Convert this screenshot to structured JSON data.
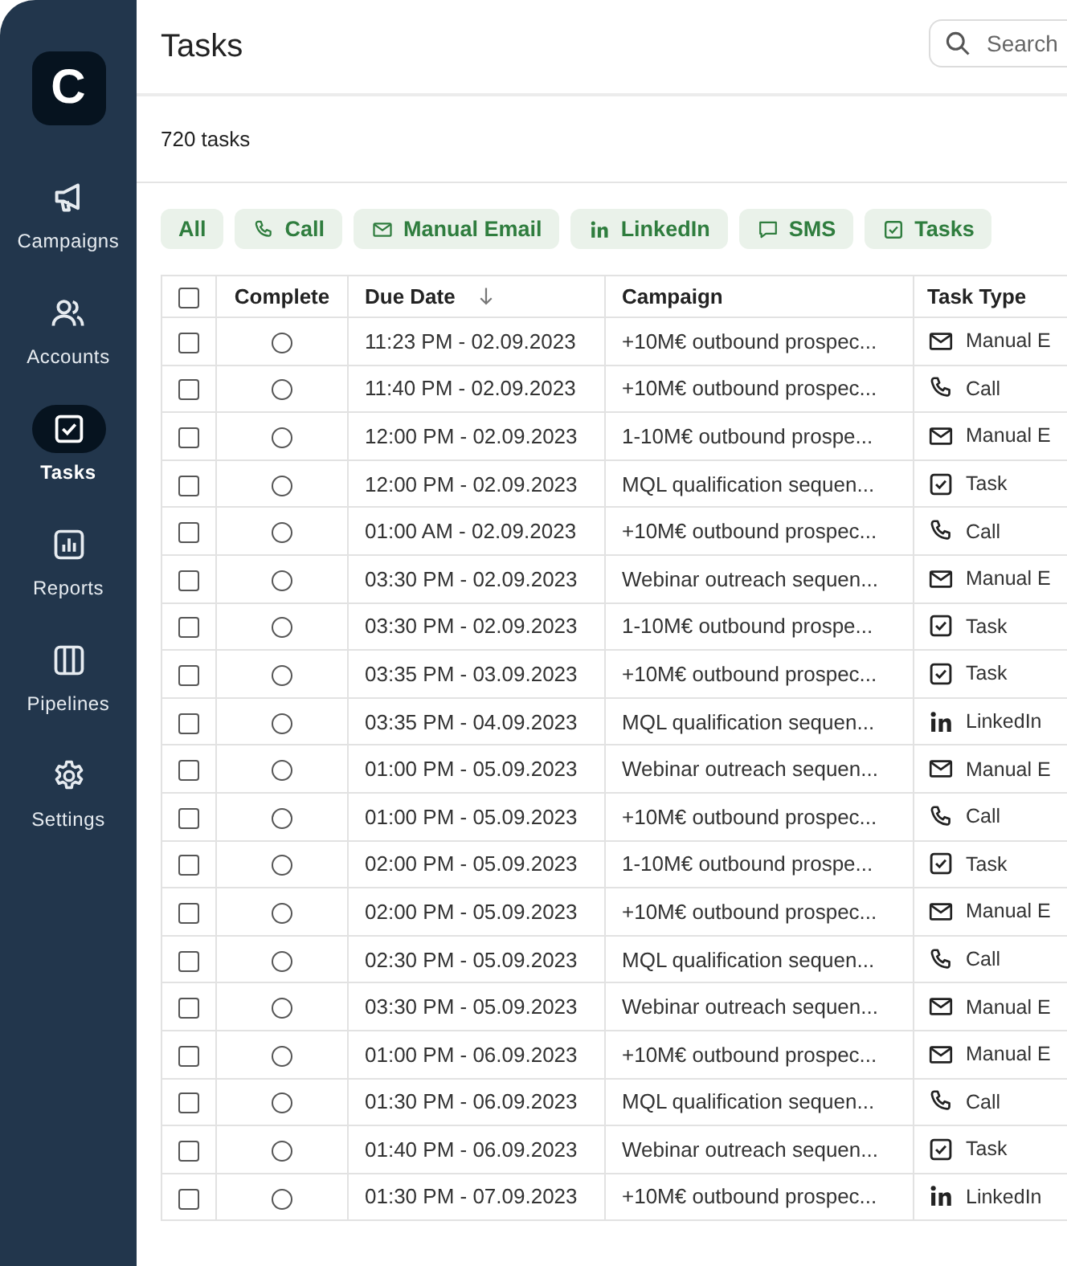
{
  "sidebar": {
    "logo": "C",
    "items": [
      {
        "label": "Campaigns",
        "selected": false
      },
      {
        "label": "Accounts",
        "selected": false
      },
      {
        "label": "Tasks",
        "selected": true
      },
      {
        "label": "Reports",
        "selected": false
      },
      {
        "label": "Pipelines",
        "selected": false
      },
      {
        "label": "Settings",
        "selected": false
      }
    ]
  },
  "header": {
    "title": "Tasks",
    "search": {
      "placeholder": "Search"
    }
  },
  "count": "720 tasks",
  "filters": [
    {
      "label": "All",
      "kind": "all"
    },
    {
      "label": "Call",
      "kind": "call"
    },
    {
      "label": "Manual Email",
      "kind": "email"
    },
    {
      "label": "LinkedIn",
      "kind": "linkedin"
    },
    {
      "label": "SMS",
      "kind": "sms"
    },
    {
      "label": "Tasks",
      "kind": "task"
    }
  ],
  "table": {
    "columns": [
      "Complete",
      "Due Date",
      "Campaign",
      "Task Type"
    ],
    "all_checked": false,
    "rows": [
      {
        "checked": false,
        "complete": false,
        "due": "11:23 PM - 02.09.2023",
        "campaign": "+10M€ outbound prospec...",
        "type": "Manual E",
        "kind": "email"
      },
      {
        "checked": false,
        "complete": false,
        "due": "11:40 PM - 02.09.2023",
        "campaign": "+10M€ outbound prospec...",
        "type": "Call",
        "kind": "call"
      },
      {
        "checked": false,
        "complete": false,
        "due": "12:00 PM - 02.09.2023",
        "campaign": "1-10M€ outbound prospe...",
        "type": "Manual E",
        "kind": "email"
      },
      {
        "checked": false,
        "complete": false,
        "due": "12:00 PM - 02.09.2023",
        "campaign": "MQL qualification sequen...",
        "type": "Task",
        "kind": "task"
      },
      {
        "checked": false,
        "complete": false,
        "due": "01:00 AM - 02.09.2023",
        "campaign": "+10M€ outbound prospec...",
        "type": "Call",
        "kind": "call"
      },
      {
        "checked": false,
        "complete": false,
        "due": "03:30 PM - 02.09.2023",
        "campaign": "Webinar outreach sequen...",
        "type": "Manual E",
        "kind": "email"
      },
      {
        "checked": false,
        "complete": false,
        "due": "03:30 PM - 02.09.2023",
        "campaign": "1-10M€ outbound prospe...",
        "type": "Task",
        "kind": "task"
      },
      {
        "checked": false,
        "complete": false,
        "due": "03:35 PM - 03.09.2023",
        "campaign": "+10M€ outbound prospec...",
        "type": "Task",
        "kind": "task"
      },
      {
        "checked": false,
        "complete": false,
        "due": "03:35 PM - 04.09.2023",
        "campaign": "MQL qualification sequen...",
        "type": "LinkedIn",
        "kind": "linkedin"
      },
      {
        "checked": false,
        "complete": false,
        "due": "01:00 PM - 05.09.2023",
        "campaign": "Webinar outreach sequen...",
        "type": "Manual E",
        "kind": "email"
      },
      {
        "checked": false,
        "complete": false,
        "due": "01:00 PM - 05.09.2023",
        "campaign": "+10M€ outbound prospec...",
        "type": "Call",
        "kind": "call"
      },
      {
        "checked": false,
        "complete": false,
        "due": "02:00 PM - 05.09.2023",
        "campaign": "1-10M€ outbound prospe...",
        "type": "Task",
        "kind": "task"
      },
      {
        "checked": false,
        "complete": false,
        "due": "02:00 PM - 05.09.2023",
        "campaign": "+10M€ outbound prospec...",
        "type": "Manual E",
        "kind": "email"
      },
      {
        "checked": false,
        "complete": false,
        "due": "02:30 PM - 05.09.2023",
        "campaign": "MQL qualification sequen...",
        "type": "Call",
        "kind": "call"
      },
      {
        "checked": false,
        "complete": false,
        "due": "03:30 PM - 05.09.2023",
        "campaign": "Webinar outreach sequen...",
        "type": "Manual E",
        "kind": "email"
      },
      {
        "checked": false,
        "complete": false,
        "due": "01:00 PM - 06.09.2023",
        "campaign": "+10M€ outbound prospec...",
        "type": "Manual E",
        "kind": "email"
      },
      {
        "checked": false,
        "complete": false,
        "due": "01:30 PM - 06.09.2023",
        "campaign": "MQL qualification sequen...",
        "type": "Call",
        "kind": "call"
      },
      {
        "checked": false,
        "complete": false,
        "due": "01:40 PM - 06.09.2023",
        "campaign": "Webinar outreach sequen...",
        "type": "Task",
        "kind": "task"
      },
      {
        "checked": false,
        "complete": false,
        "due": "01:30 PM - 07.09.2023",
        "campaign": "+10M€ outbound prospec...",
        "type": "LinkedIn",
        "kind": "linkedin"
      }
    ]
  }
}
